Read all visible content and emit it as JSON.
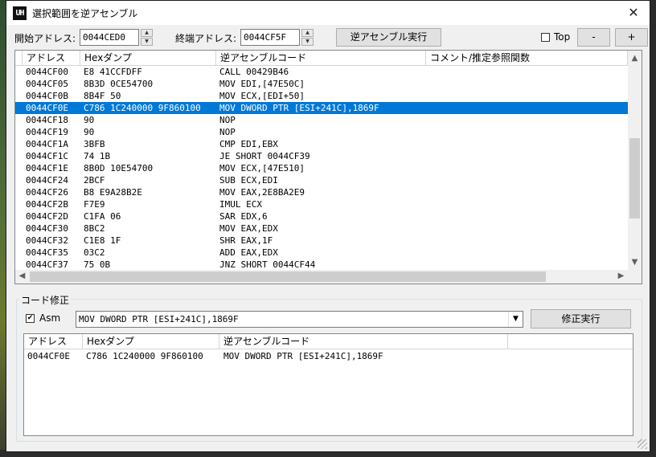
{
  "window": {
    "icon_text": "UH",
    "title": "選択範囲を逆アセンブル",
    "close_glyph": "✕"
  },
  "toolbar": {
    "start_label": "開始アドレス:",
    "start_value": "0044CED0",
    "end_label": "終端アドレス:",
    "end_value": "0044CF5F",
    "disasm_button": "逆アセンブル実行",
    "top_label": "Top",
    "top_checked": false,
    "minus_button": "-",
    "plus_button": "+",
    "spin_up": "▲",
    "spin_down": "▼"
  },
  "main_list": {
    "columns": [
      "アドレス",
      "Hexダンプ",
      "逆アセンブルコード",
      "コメント/推定参照関数"
    ],
    "selected_index": 3,
    "rows": [
      [
        "0044CF00",
        "E8 41CCFDFF",
        "CALL 00429B46",
        ""
      ],
      [
        "0044CF05",
        "8B3D 0CE54700",
        "MOV EDI,[47E50C]",
        ""
      ],
      [
        "0044CF0B",
        "8B4F 50",
        "MOV ECX,[EDI+50]",
        ""
      ],
      [
        "0044CF0E",
        "C786 1C240000 9F860100",
        "MOV DWORD PTR [ESI+241C],1869F",
        ""
      ],
      [
        "0044CF18",
        "90",
        "NOP",
        ""
      ],
      [
        "0044CF19",
        "90",
        "NOP",
        ""
      ],
      [
        "0044CF1A",
        "3BFB",
        "CMP EDI,EBX",
        ""
      ],
      [
        "0044CF1C",
        "74 1B",
        "JE SHORT 0044CF39",
        ""
      ],
      [
        "0044CF1E",
        "8B0D 10E54700",
        "MOV ECX,[47E510]",
        ""
      ],
      [
        "0044CF24",
        "2BCF",
        "SUB ECX,EDI",
        ""
      ],
      [
        "0044CF26",
        "B8 E9A28B2E",
        "MOV EAX,2E8BA2E9",
        ""
      ],
      [
        "0044CF2B",
        "F7E9",
        "IMUL ECX",
        ""
      ],
      [
        "0044CF2D",
        "C1FA 06",
        "SAR EDX,6",
        ""
      ],
      [
        "0044CF30",
        "8BC2",
        "MOV EAX,EDX",
        ""
      ],
      [
        "0044CF32",
        "C1E8 1F",
        "SHR EAX,1F",
        ""
      ],
      [
        "0044CF35",
        "03C2",
        "ADD EAX,EDX",
        ""
      ],
      [
        "0044CF37",
        "75 0B",
        "JNZ SHORT 0044CF44",
        ""
      ]
    ],
    "scroll_up": "▲",
    "scroll_down": "▼",
    "scroll_left": "◀",
    "scroll_right": "▶"
  },
  "edit_group": {
    "title": "コード修正",
    "asm_label": "Asm",
    "asm_checked": true,
    "check_glyph": "✔",
    "code_value": "MOV DWORD PTR [ESI+241C],1869F",
    "combo_arrow": "▼",
    "apply_button": "修正実行",
    "result_columns": [
      "アドレス",
      "Hexダンプ",
      "逆アセンブルコード",
      ""
    ],
    "result_rows": [
      [
        "0044CF0E",
        "C786 1C240000 9F860100",
        "MOV DWORD PTR [ESI+241C],1869F"
      ]
    ]
  },
  "colors": {
    "selection": "#0078d7",
    "window_bg": "#f0f0f0"
  }
}
